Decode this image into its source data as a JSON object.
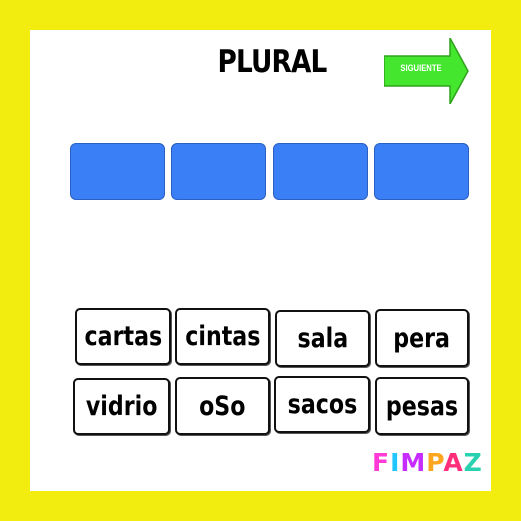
{
  "title": "PLURAL",
  "next_button": {
    "label": "SIGUIENTE"
  },
  "slots_count": 4,
  "cards": [
    "cartas",
    "cintas",
    "sala",
    "pera",
    "vidrio",
    "oSo",
    "sacos",
    "pesas"
  ],
  "brand": {
    "letters": [
      {
        "char": "F",
        "color": "#ff3ad6"
      },
      {
        "char": "I",
        "color": "#1fc6ff"
      },
      {
        "char": "M",
        "color": "#c62bff"
      },
      {
        "char": "P",
        "color": "#ffa51f"
      },
      {
        "char": "A",
        "color": "#ff2e7a"
      },
      {
        "char": "Z",
        "color": "#2ad1b0"
      }
    ]
  },
  "colors": {
    "background": "#f2ec0f",
    "slot": "#3a7ff5",
    "next_button": "#44e62e"
  }
}
